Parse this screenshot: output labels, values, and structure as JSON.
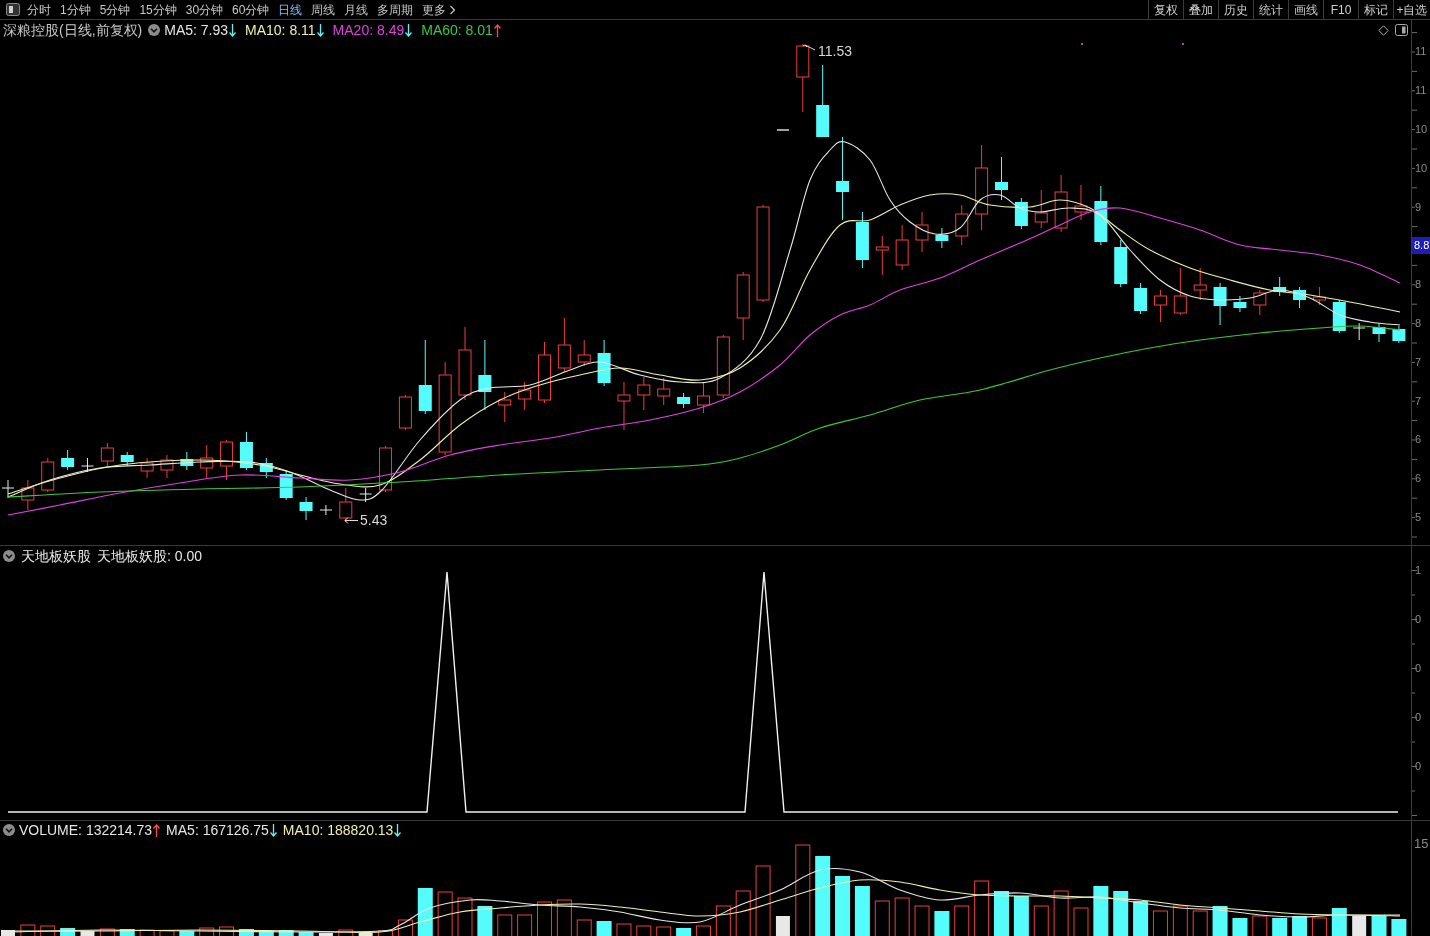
{
  "toolbar": {
    "periods": [
      {
        "label": "分时",
        "selected": false,
        "kind": "tab"
      },
      {
        "label": "1分钟",
        "selected": false,
        "kind": "tab"
      },
      {
        "label": "5分钟",
        "selected": false,
        "kind": "tab"
      },
      {
        "label": "15分钟",
        "selected": false,
        "kind": "tab"
      },
      {
        "label": "30分钟",
        "selected": false,
        "kind": "tab"
      },
      {
        "label": "60分钟",
        "selected": false,
        "kind": "tab"
      },
      {
        "label": "日线",
        "selected": true,
        "kind": "tab"
      },
      {
        "label": "周线",
        "selected": false,
        "kind": "tab"
      },
      {
        "label": "月线",
        "selected": false,
        "kind": "tab"
      },
      {
        "label": "多周期",
        "selected": false,
        "kind": "tab"
      },
      {
        "label": "更多",
        "selected": false,
        "kind": "menu"
      }
    ],
    "buttons": [
      "复权",
      "叠加",
      "历史",
      "统计",
      "画线",
      "F10",
      "标记",
      "+自选"
    ]
  },
  "main_pane": {
    "title": "深粮控股(日线,前复权)",
    "indicators": [
      {
        "label": "MA5: 7.93",
        "rising": false,
        "color": "#e6e6e6"
      },
      {
        "label": "MA10: 8.11",
        "rising": false,
        "color": "#f0f0a8"
      },
      {
        "label": "MA20: 8.49",
        "rising": false,
        "color": "#e040e0"
      },
      {
        "label": "MA60: 8.01",
        "rising": true,
        "color": "#3cc83c"
      }
    ],
    "high_label": "11.53",
    "low_label": "5.43",
    "axis_labels": [
      {
        "text": "11",
        "highlighted": false
      },
      {
        "text": "11",
        "highlighted": false
      },
      {
        "text": "10",
        "highlighted": false
      },
      {
        "text": "10",
        "highlighted": false
      },
      {
        "text": "9",
        "highlighted": false
      },
      {
        "text": "8.8",
        "highlighted": true
      },
      {
        "text": "8",
        "highlighted": false
      },
      {
        "text": "8",
        "highlighted": false
      },
      {
        "text": "7",
        "highlighted": false
      },
      {
        "text": "7",
        "highlighted": false
      },
      {
        "text": "6",
        "highlighted": false
      },
      {
        "text": "6",
        "highlighted": false
      },
      {
        "text": "5",
        "highlighted": false
      }
    ]
  },
  "indicator_pane": {
    "name": "天地板妖股",
    "value": "天地板妖股: 0.00",
    "axis_labels": [
      "1",
      "0",
      "0",
      "0",
      "0"
    ]
  },
  "volume_pane": {
    "indicators": [
      {
        "label": "VOLUME: 132214.73",
        "rising": true,
        "color": "#e6e6e6"
      },
      {
        "label": "MA5: 167126.75",
        "rising": false,
        "color": "#e6e6e6"
      },
      {
        "label": "MA10: 188820.13",
        "rising": false,
        "color": "#f0f0a8"
      }
    ],
    "axis_labels": [
      "15"
    ]
  }
}
